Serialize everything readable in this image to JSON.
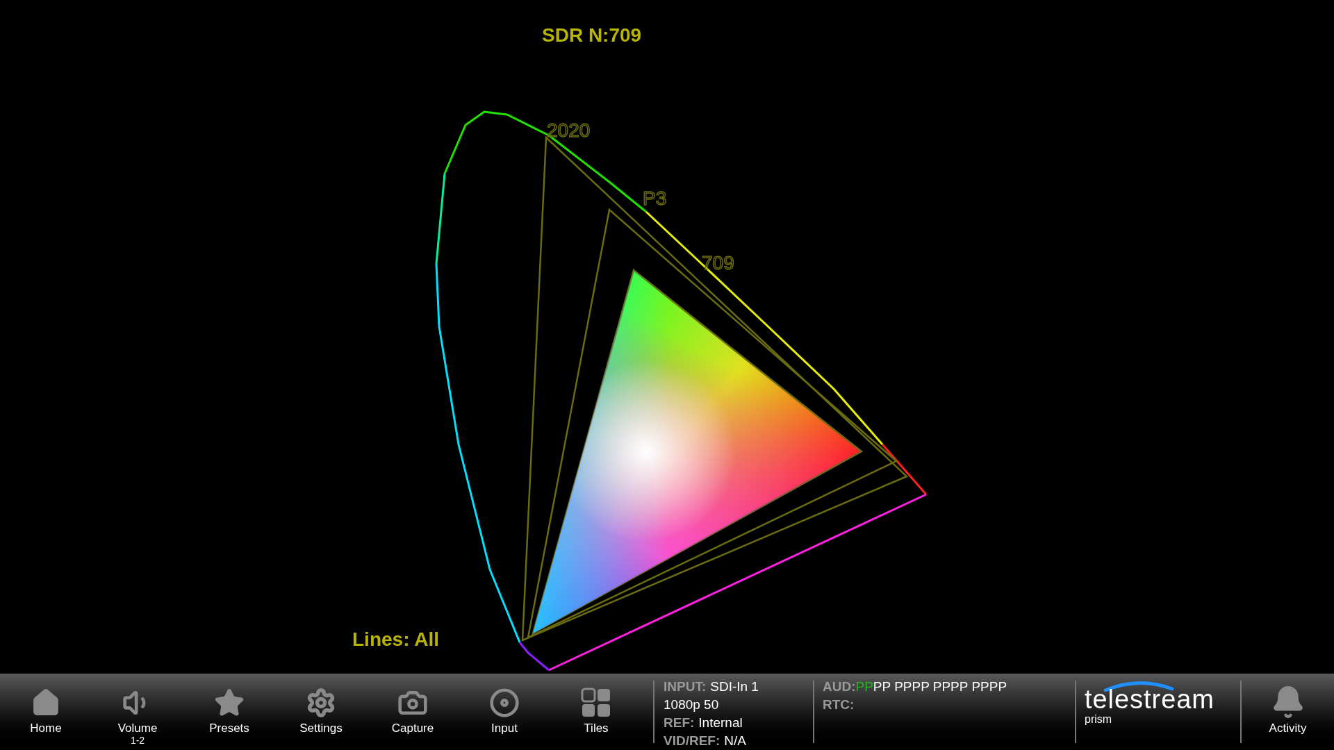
{
  "scope": {
    "title": "SDR N:709",
    "lines": "Lines: All",
    "gamut_labels": [
      "2020",
      "P3",
      "709"
    ]
  },
  "toolbar": [
    {
      "kind": "home",
      "label": "Home"
    },
    {
      "kind": "volume",
      "label": "Volume",
      "sublabel": "1-2"
    },
    {
      "kind": "presets",
      "label": "Presets"
    },
    {
      "kind": "settings",
      "label": "Settings"
    },
    {
      "kind": "capture",
      "label": "Capture"
    },
    {
      "kind": "input",
      "label": "Input"
    },
    {
      "kind": "tiles",
      "label": "Tiles"
    }
  ],
  "status": {
    "rows": [
      {
        "label": "INPUT:",
        "value": "SDI-In 1"
      },
      {
        "label": "",
        "value": "1080p 50"
      },
      {
        "label": "REF:",
        "value": "Internal"
      },
      {
        "label": "VID/REF:",
        "value": "N/A"
      }
    ],
    "aud_label": "AUD:",
    "aud": [
      {
        "text": "PP",
        "color": "#22b422"
      },
      {
        "text": "PP PPPP PPPP PPPP",
        "color": "#ffffff"
      }
    ],
    "rtc_label": "RTC:"
  },
  "logo": {
    "name": "telestream",
    "product": "prism"
  },
  "activity": {
    "label": "Activity"
  }
}
